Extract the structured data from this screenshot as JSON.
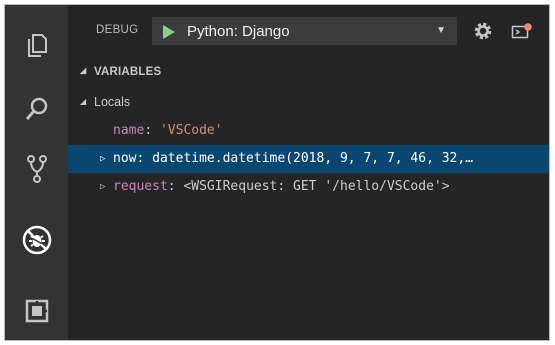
{
  "debug": {
    "title": "DEBUG",
    "configuration": "Python: Django"
  },
  "variables": {
    "section_title": "VARIABLES",
    "scope_label": "Locals",
    "items": [
      {
        "name": "name",
        "separator": ":",
        "value": "'VSCode'",
        "expandable": false,
        "selected": false
      },
      {
        "name": "now",
        "separator": ":",
        "value": "datetime.datetime(2018, 9, 7, 7, 46, 32,…",
        "expandable": true,
        "selected": true
      },
      {
        "name": "request",
        "separator": ":",
        "value": "<WSGIRequest: GET '/hello/VSCode'>",
        "expandable": true,
        "selected": false
      }
    ]
  },
  "activity_bar": {
    "icons": [
      "explorer-icon",
      "search-icon",
      "source-control-icon",
      "debug-icon",
      "extensions-icon"
    ]
  },
  "colors": {
    "background": "#252526",
    "activity_bar": "#333333",
    "selection": "#094771",
    "play": "#89d185",
    "var_name": "#c586c0",
    "string_value": "#ce9178"
  }
}
